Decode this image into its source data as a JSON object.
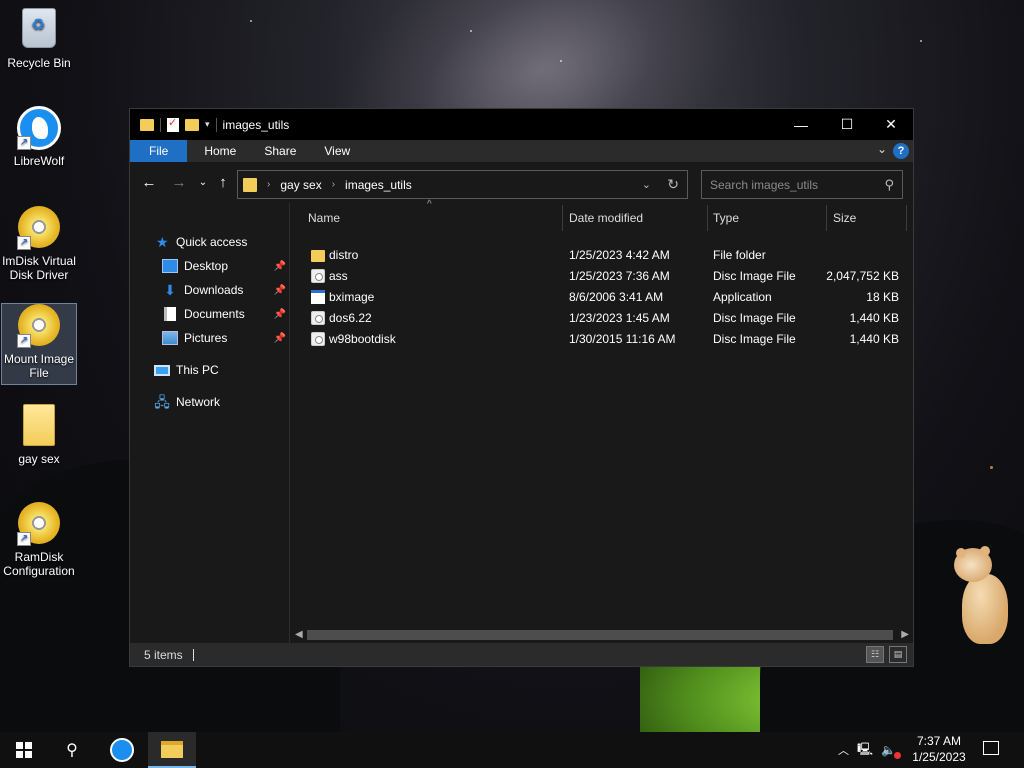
{
  "desktop": {
    "icons": [
      {
        "label": "Recycle Bin"
      },
      {
        "label": "LibreWolf"
      },
      {
        "label": "ImDisk Virtual Disk Driver"
      },
      {
        "label": "Mount Image File"
      },
      {
        "label": "gay sex"
      },
      {
        "label": "RamDisk Configuration"
      }
    ]
  },
  "window": {
    "title": "images_utils",
    "controls": {
      "minimize": "—",
      "maximize": "☐",
      "close": "✕"
    },
    "ribbon_tabs": [
      "File",
      "Home",
      "Share",
      "View"
    ],
    "ribbon_help": "?",
    "address": {
      "crumbs": [
        "gay sex",
        "images_utils"
      ],
      "separator": "›"
    },
    "search": {
      "placeholder": "Search images_utils"
    },
    "nav": {
      "quick_access": "Quick access",
      "items": [
        {
          "label": "Desktop",
          "icon": "desktop-icon"
        },
        {
          "label": "Downloads",
          "icon": "download-icon"
        },
        {
          "label": "Documents",
          "icon": "document-icon"
        },
        {
          "label": "Pictures",
          "icon": "pictures-icon"
        }
      ],
      "this_pc": "This PC",
      "network": "Network"
    },
    "columns": [
      "Name",
      "Date modified",
      "Type",
      "Size"
    ],
    "files": [
      {
        "name": "distro",
        "date": "1/25/2023 4:42 AM",
        "type": "File folder",
        "size": "",
        "icon": "folder"
      },
      {
        "name": "ass",
        "date": "1/25/2023 7:36 AM",
        "type": "Disc Image File",
        "size": "2,047,752 KB",
        "icon": "disc"
      },
      {
        "name": "bximage",
        "date": "8/6/2006 3:41 AM",
        "type": "Application",
        "size": "18 KB",
        "icon": "app"
      },
      {
        "name": "dos6.22",
        "date": "1/23/2023 1:45 AM",
        "type": "Disc Image File",
        "size": "1,440 KB",
        "icon": "disc"
      },
      {
        "name": "w98bootdisk",
        "date": "1/30/2015 11:16 AM",
        "type": "Disc Image File",
        "size": "1,440 KB",
        "icon": "disc"
      }
    ],
    "status": "5 items"
  },
  "taskbar": {
    "time": "7:37 AM",
    "date": "1/25/2023"
  },
  "colors": {
    "accent": "#1f6fc5",
    "window_bg": "#191919",
    "titlebar_bg": "#000000",
    "folder": "#f3cd5a"
  }
}
